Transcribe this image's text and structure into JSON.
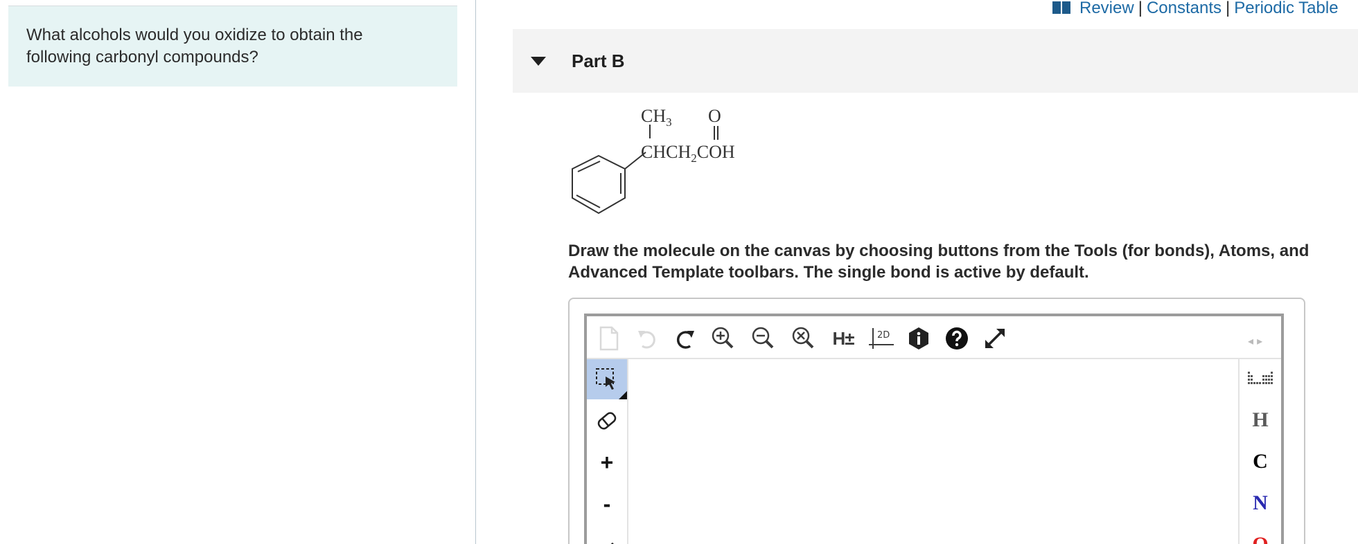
{
  "question": {
    "text": "What alcohols would you oxidize to obtain the following carbonyl compounds?"
  },
  "top_links": {
    "review": "Review",
    "constants": "Constants",
    "periodic_table": "Periodic Table",
    "separator": "|"
  },
  "part": {
    "title": "Part B"
  },
  "molecule": {
    "ch3": "CH",
    "ch3_sub": "3",
    "o": "O",
    "chain_a": "CHCH",
    "chain_sub": "2",
    "chain_b": "COH"
  },
  "instructions": {
    "line1": "Draw the molecule on the canvas by choosing buttons from the Tools (for bonds), Atoms, and",
    "line2": "Advanced Template toolbars. The single bond is active by default."
  },
  "toolbar": {
    "hydrogen_label": "H±",
    "twod_label": "2D",
    "nav_label": "◂ ▸"
  },
  "left_tools": {
    "plus": "+",
    "minus": "-"
  },
  "atoms": [
    {
      "symbol": "H",
      "color": "#5a5a5a"
    },
    {
      "symbol": "C",
      "color": "#000000"
    },
    {
      "symbol": "N",
      "color": "#2a2ab0"
    },
    {
      "symbol": "O",
      "color": "#e02020"
    }
  ],
  "colors": {
    "link": "#1d6aa5",
    "question_bg": "#e6f4f4",
    "part_header_bg": "#f3f3f3",
    "active_tool": "#b6ccec"
  }
}
